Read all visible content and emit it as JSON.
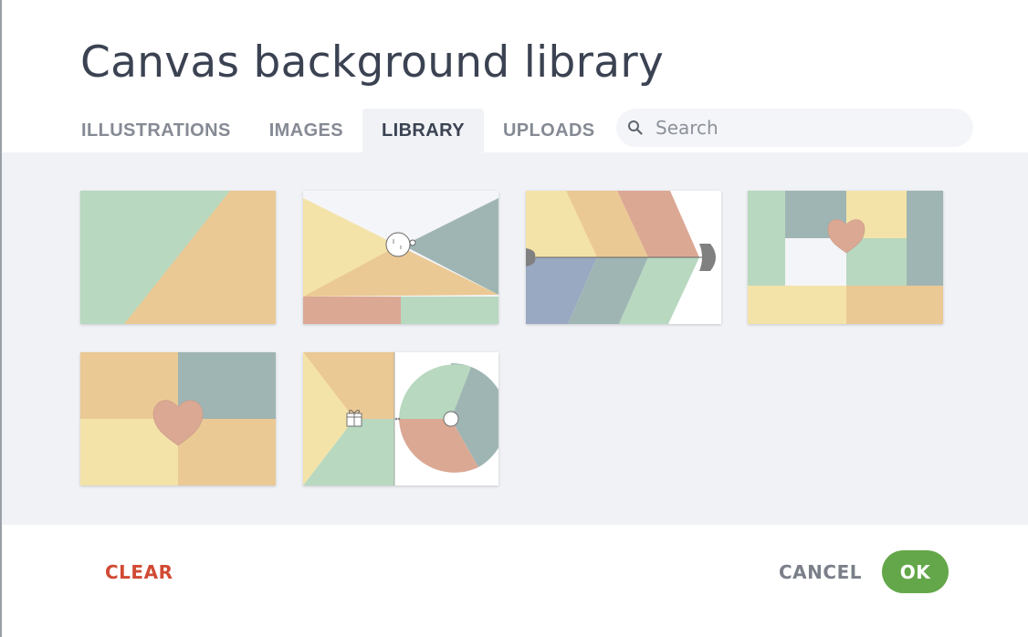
{
  "dialog": {
    "title": "Canvas background library"
  },
  "tabs": [
    {
      "label": "ILLUSTRATIONS",
      "active": false
    },
    {
      "label": "IMAGES",
      "active": false
    },
    {
      "label": "LIBRARY",
      "active": true
    },
    {
      "label": "UPLOADS",
      "active": false
    }
  ],
  "search": {
    "placeholder": "Search",
    "value": "",
    "icon": "search-icon"
  },
  "library_items": [
    {
      "name": "diagonal-split-template",
      "colors": [
        "#b8d8c0",
        "#ebc994"
      ]
    },
    {
      "name": "center-circle-bowtie-template",
      "colors": [
        "#f4e3a8",
        "#9fb5b3",
        "#ebc994",
        "#dba894",
        "#b8d8c0"
      ]
    },
    {
      "name": "fishbone-template",
      "colors": [
        "#f4e3a8",
        "#ebc994",
        "#dba894",
        "#9aa9c2",
        "#9fb5b3",
        "#b8d8c0"
      ]
    },
    {
      "name": "heart-grid-template",
      "colors": [
        "#b8d8c0",
        "#9fb5b3",
        "#f4e3a8",
        "#ebc994",
        "#dba894"
      ]
    },
    {
      "name": "heart-quadrant-template",
      "colors": [
        "#ebc994",
        "#9fb5b3",
        "#f4e3a8",
        "#dba894"
      ]
    },
    {
      "name": "gift-and-wheel-template",
      "colors": [
        "#ebc994",
        "#f4e3a8",
        "#b8d8c0",
        "#9fb5b3",
        "#dba894"
      ]
    }
  ],
  "footer": {
    "clear_label": "CLEAR",
    "cancel_label": "CANCEL",
    "ok_label": "OK"
  },
  "colors": {
    "title": "#3b4252",
    "accent_ok": "#64a74a",
    "danger": "#d14a33",
    "gallery_bg": "#f0f2f6"
  }
}
